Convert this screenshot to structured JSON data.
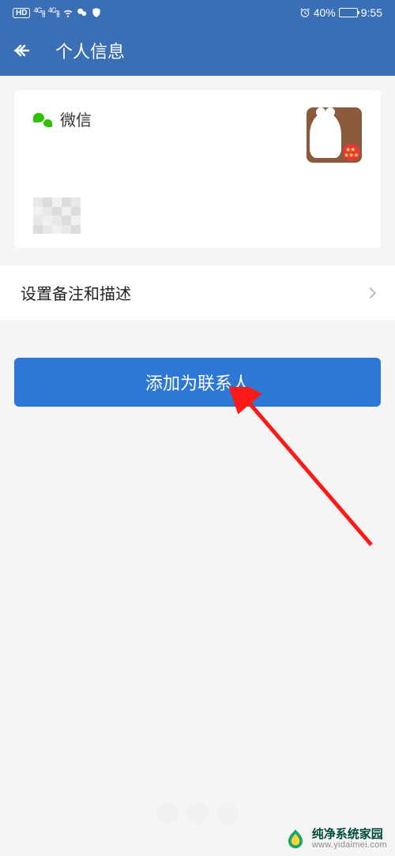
{
  "status": {
    "hd": "HD",
    "sim1": "4G",
    "sim2": "4G",
    "battery_pct": "40%",
    "time": "9:55"
  },
  "header": {
    "title": "个人信息"
  },
  "card": {
    "service_name": "微信"
  },
  "rows": {
    "remark_label": "设置备注和描述"
  },
  "actions": {
    "add_contact_label": "添加为联系人"
  },
  "watermark": {
    "line1": "纯净系统家园",
    "line2": "www.yidaimei.com"
  }
}
